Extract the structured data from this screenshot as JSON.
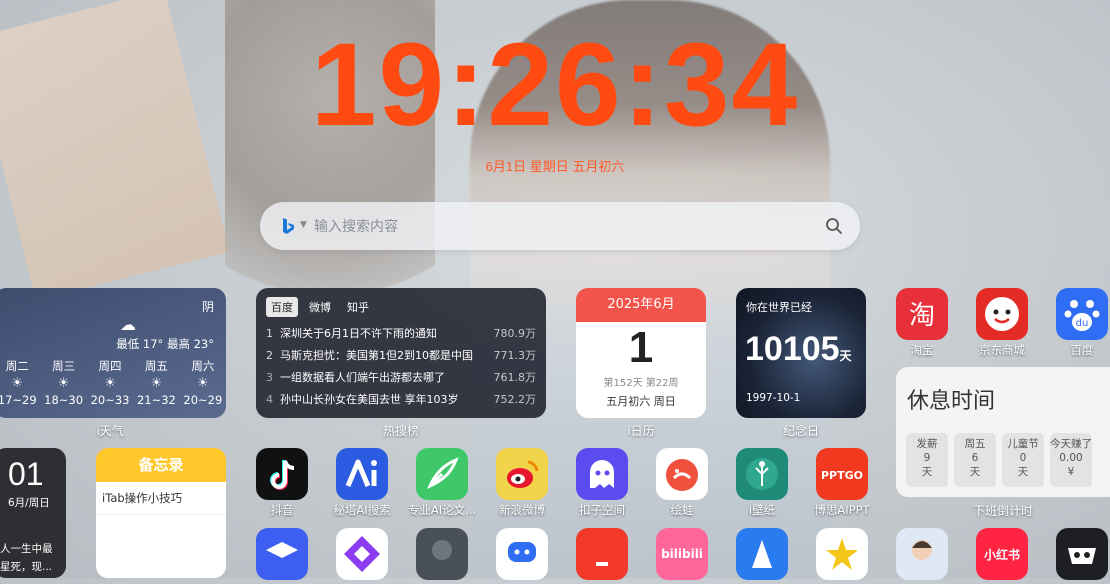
{
  "clock": {
    "time": "19:26:34",
    "date_line": "6月1日  星期日  五月初六"
  },
  "search": {
    "placeholder": "输入搜索内容"
  },
  "weather": {
    "label": "i天气",
    "condition": "阴",
    "range": "最低 17° 最高 23°",
    "days": [
      {
        "name": "周二",
        "temp": "17~29"
      },
      {
        "name": "周三",
        "temp": "18~30"
      },
      {
        "name": "周四",
        "temp": "20~33"
      },
      {
        "name": "周五",
        "temp": "21~32"
      },
      {
        "name": "周六",
        "temp": "20~29"
      }
    ]
  },
  "hot": {
    "label": "热搜榜",
    "tabs": [
      "百度",
      "微博",
      "知乎"
    ],
    "items": [
      {
        "rank": "1",
        "title": "深圳关于6月1日不许下雨的通知",
        "value": "780.9万"
      },
      {
        "rank": "2",
        "title": "马斯克担忧：美国第1但2到10都是中国",
        "value": "771.3万"
      },
      {
        "rank": "3",
        "title": "一组数据看人们端午出游都去哪了",
        "value": "761.8万"
      },
      {
        "rank": "4",
        "title": "孙中山长孙女在美国去世 享年103岁",
        "value": "752.2万"
      }
    ]
  },
  "calendar": {
    "label": "i日历",
    "month": "2025年6月",
    "day": "1",
    "week": "第152天 第22周",
    "lunar": "五月初六 周日"
  },
  "anniversary": {
    "label": "纪念日",
    "title": "你在世界已经",
    "days": "10105",
    "unit": "天",
    "date": "1997-10-1"
  },
  "rest": {
    "label": "下班倒计时",
    "title": "休息时间",
    "cells": [
      {
        "a": "发薪",
        "b": "9",
        "c": "天"
      },
      {
        "a": "周五",
        "b": "6",
        "c": "天"
      },
      {
        "a": "儿童节",
        "b": "0",
        "c": "天"
      },
      {
        "a": "今天赚了",
        "b": "0.00",
        "c": "¥"
      }
    ]
  },
  "mini_clock": {
    "hour": "01",
    "date": "6月/周日",
    "quote1": "人一生中最",
    "quote2": "星死，现..."
  },
  "memo": {
    "title": "备忘录",
    "item": "iTab操作小技巧"
  },
  "apps_row1": [
    {
      "name": "淘宝"
    },
    {
      "name": "京东商城"
    },
    {
      "name": "百度"
    }
  ],
  "apps_row2": [
    {
      "name": "抖音"
    },
    {
      "name": "秘塔AI搜索"
    },
    {
      "name": "专业AI论文..."
    },
    {
      "name": "新浪微博"
    },
    {
      "name": "扣子空间"
    },
    {
      "name": "绘蛙"
    },
    {
      "name": "i壁纸"
    },
    {
      "name": "博思AIPPT"
    }
  ],
  "app_texts": {
    "taobao": "淘",
    "baidu": "du",
    "pptgo": "PPTGO",
    "bilibili": "bilibili",
    "xhs": "小红书"
  },
  "colors": {
    "accent": "#ff4a12"
  }
}
